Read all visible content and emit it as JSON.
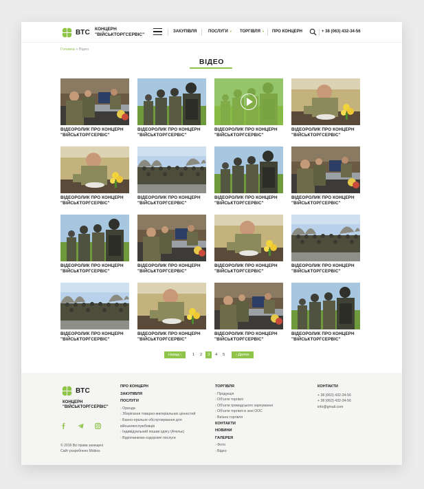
{
  "header": {
    "logo_abbr": "ВТС",
    "logo_name": "КОНЦЕРН \"ВІЙСЬКТОРГСЕРВІС\"",
    "nav": [
      "ЗАКУПІВЛЯ",
      "ПОСЛУГИ",
      "ТОРГІВЛЯ",
      "ПРО КОНЦЕРН"
    ],
    "phone": "+ 38 (063) 432-34-56"
  },
  "breadcrumb": {
    "home": "Головна",
    "separator": "»",
    "current": "Відео"
  },
  "page_title": "ВІДЕО",
  "videos": [
    {
      "caption": "ВІДЕОРОЛИК ПРО КОНЦЕРН \"ВІЙСЬКТОРГСЕРВІС\"",
      "scene": "canteen"
    },
    {
      "caption": "ВІДЕОРОЛИК ПРО КОНЦЕРН \"ВІЙСЬКТОРГСЕРВІС\"",
      "scene": "soldiers-close"
    },
    {
      "caption": "ВІДЕОРОЛИК ПРО КОНЦЕРН \"ВІЙСЬКТОРГСЕРВІС\"",
      "scene": "soldiers-close"
    },
    {
      "caption": "ВІДЕОРОЛИК ПРО КОНЦЕРН \"ВІЙСЬКТОРГСЕРВІС\"",
      "scene": "eating"
    },
    {
      "caption": "ВІДЕОРОЛИК ПРО КОНЦЕРН \"ВІЙСЬКТОРГСЕРВІС\"",
      "scene": "eating"
    },
    {
      "caption": "ВІДЕОРОЛИК ПРО КОНЦЕРН \"ВІЙСЬКТОРГСЕРВІС\"",
      "scene": "formation"
    },
    {
      "caption": "ВІДЕОРОЛИК ПРО КОНЦЕРН \"ВІЙСЬКТОРГСЕРВІС\"",
      "scene": "soldiers-close"
    },
    {
      "caption": "ВІДЕОРОЛИК ПРО КОНЦЕРН \"ВІЙСЬКТОРГСЕРВІС\"",
      "scene": "canteen"
    },
    {
      "caption": "ВІДЕОРОЛИК ПРО КОНЦЕРН \"ВІЙСЬКТОРГСЕРВІС\"",
      "scene": "soldiers-close"
    },
    {
      "caption": "ВІДЕОРОЛИК ПРО КОНЦЕРН \"ВІЙСЬКТОРГСЕРВІС\"",
      "scene": "canteen"
    },
    {
      "caption": "ВІДЕОРОЛИК ПРО КОНЦЕРН \"ВІЙСЬКТОРГСЕРВІС\"",
      "scene": "eating"
    },
    {
      "caption": "ВІДЕОРОЛИК ПРО КОНЦЕРН \"ВІЙСЬКТОРГСЕРВІС\"",
      "scene": "formation"
    },
    {
      "caption": "ВІДЕОРОЛИК ПРО КОНЦЕРН \"ВІЙСЬКТОРГСЕРВІС\"",
      "scene": "formation"
    },
    {
      "caption": "ВІДЕОРОЛИК ПРО КОНЦЕРН \"ВІЙСЬКТОРГСЕРВІС\"",
      "scene": "eating"
    },
    {
      "caption": "ВІДЕОРОЛИК ПРО КОНЦЕРН \"ВІЙСЬКТОРГСЕРВІС\"",
      "scene": "canteen"
    },
    {
      "caption": "ВІДЕОРОЛИК ПРО КОНЦЕРН \"ВІЙСЬКТОРГСЕРВІС\"",
      "scene": "soldiers-close"
    }
  ],
  "active_video_index": 2,
  "pagination": {
    "prev": "Назад",
    "next": "Далее",
    "pages": [
      "1",
      "2",
      "3",
      "4",
      "5"
    ],
    "current": "3"
  },
  "footer": {
    "logo_abbr": "ВТС",
    "logo_name": "КОНЦЕРН \"ВІЙСЬКТОРГСЕРВІС\"",
    "social": [
      "facebook-icon",
      "telegram-icon",
      "instagram-icon"
    ],
    "copyright": "© 2018 Всі права захищені",
    "developer": "Сайт розроблено Mobios",
    "col1": {
      "about": "ПРО КОНЦЕРН",
      "purchases": "ЗАКУПІВЛЯ",
      "services": "ПОСЛУГИ",
      "service_items": [
        "Оренда",
        "Зберігання товарно-матеріальних цінностей",
        "Банно-пральне обслуговування для військовослужбовців",
        "Індивідуальний пошив одягу (Ательє)",
        "Відпочинково-оздоровчі послуги"
      ]
    },
    "col2": {
      "trade": "ТОРГІВЛЯ",
      "trade_items": [
        "Продукція",
        "Об'єкти торгівлі",
        "Об'єкти громадського харчування",
        "Об'єкти торгівлі в зоні ООС",
        "Виїзна торгівля"
      ],
      "contacts": "КОНТАКТИ",
      "news": "НОВИНИ",
      "gallery": "ГАЛЕРЕЯ",
      "gallery_items": [
        "Фото",
        "Відео"
      ]
    },
    "col3": {
      "contacts": "КОНТАКТИ",
      "phone1": "+ 38 (063) 432-34-56",
      "phone2": "+ 38 (063) 432-34-56",
      "email": "info@gmail.com"
    }
  },
  "colors": {
    "accent": "#8ec449",
    "text": "#1e1e1e",
    "footer_bg": "#f5f6f4"
  }
}
